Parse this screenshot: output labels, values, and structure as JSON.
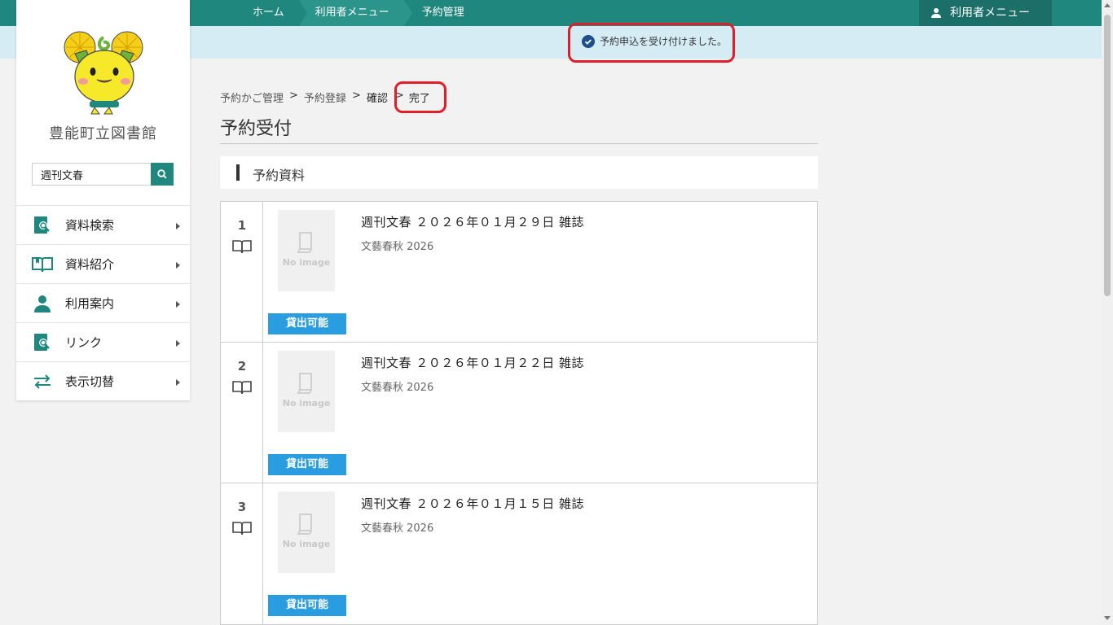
{
  "header": {
    "breadcrumb": [
      "ホーム",
      "利用者メニュー",
      "予約管理"
    ],
    "user_menu_label": "利用者メニュー"
  },
  "notice": {
    "message": "予約申込を受け付けました。"
  },
  "sidebar": {
    "library_name": "豊能町立図書館",
    "search": {
      "value": "週刊文春"
    },
    "items": [
      {
        "label": "資料検索",
        "icon": "book-search-icon"
      },
      {
        "label": "資料紹介",
        "icon": "open-book-icon"
      },
      {
        "label": "利用案内",
        "icon": "person-icon"
      },
      {
        "label": "リンク",
        "icon": "link-icon"
      },
      {
        "label": "表示切替",
        "icon": "swap-icon"
      }
    ]
  },
  "steps": {
    "items": [
      "予約かご管理",
      "予約登録",
      "確認",
      "完了"
    ],
    "separator": ">"
  },
  "page_title": "予約受付",
  "section_title": "予約資料",
  "reservations": [
    {
      "num": "1",
      "title": "週刊文春 ２０２６年０１月２９日 雑誌",
      "publisher": "文藝春秋 2026",
      "status": "貸出可能",
      "no_image": "No image"
    },
    {
      "num": "2",
      "title": "週刊文春 ２０２６年０１月２２日 雑誌",
      "publisher": "文藝春秋 2026",
      "status": "貸出可能",
      "no_image": "No image"
    },
    {
      "num": "3",
      "title": "週刊文春 ２０２６年０１月１５日 雑誌",
      "publisher": "文藝春秋 2026",
      "status": "貸出可能",
      "no_image": "No image"
    }
  ],
  "colors": {
    "brand": "#1f877e",
    "status_button": "#2a9de0",
    "highlight": "#e01e2a"
  }
}
